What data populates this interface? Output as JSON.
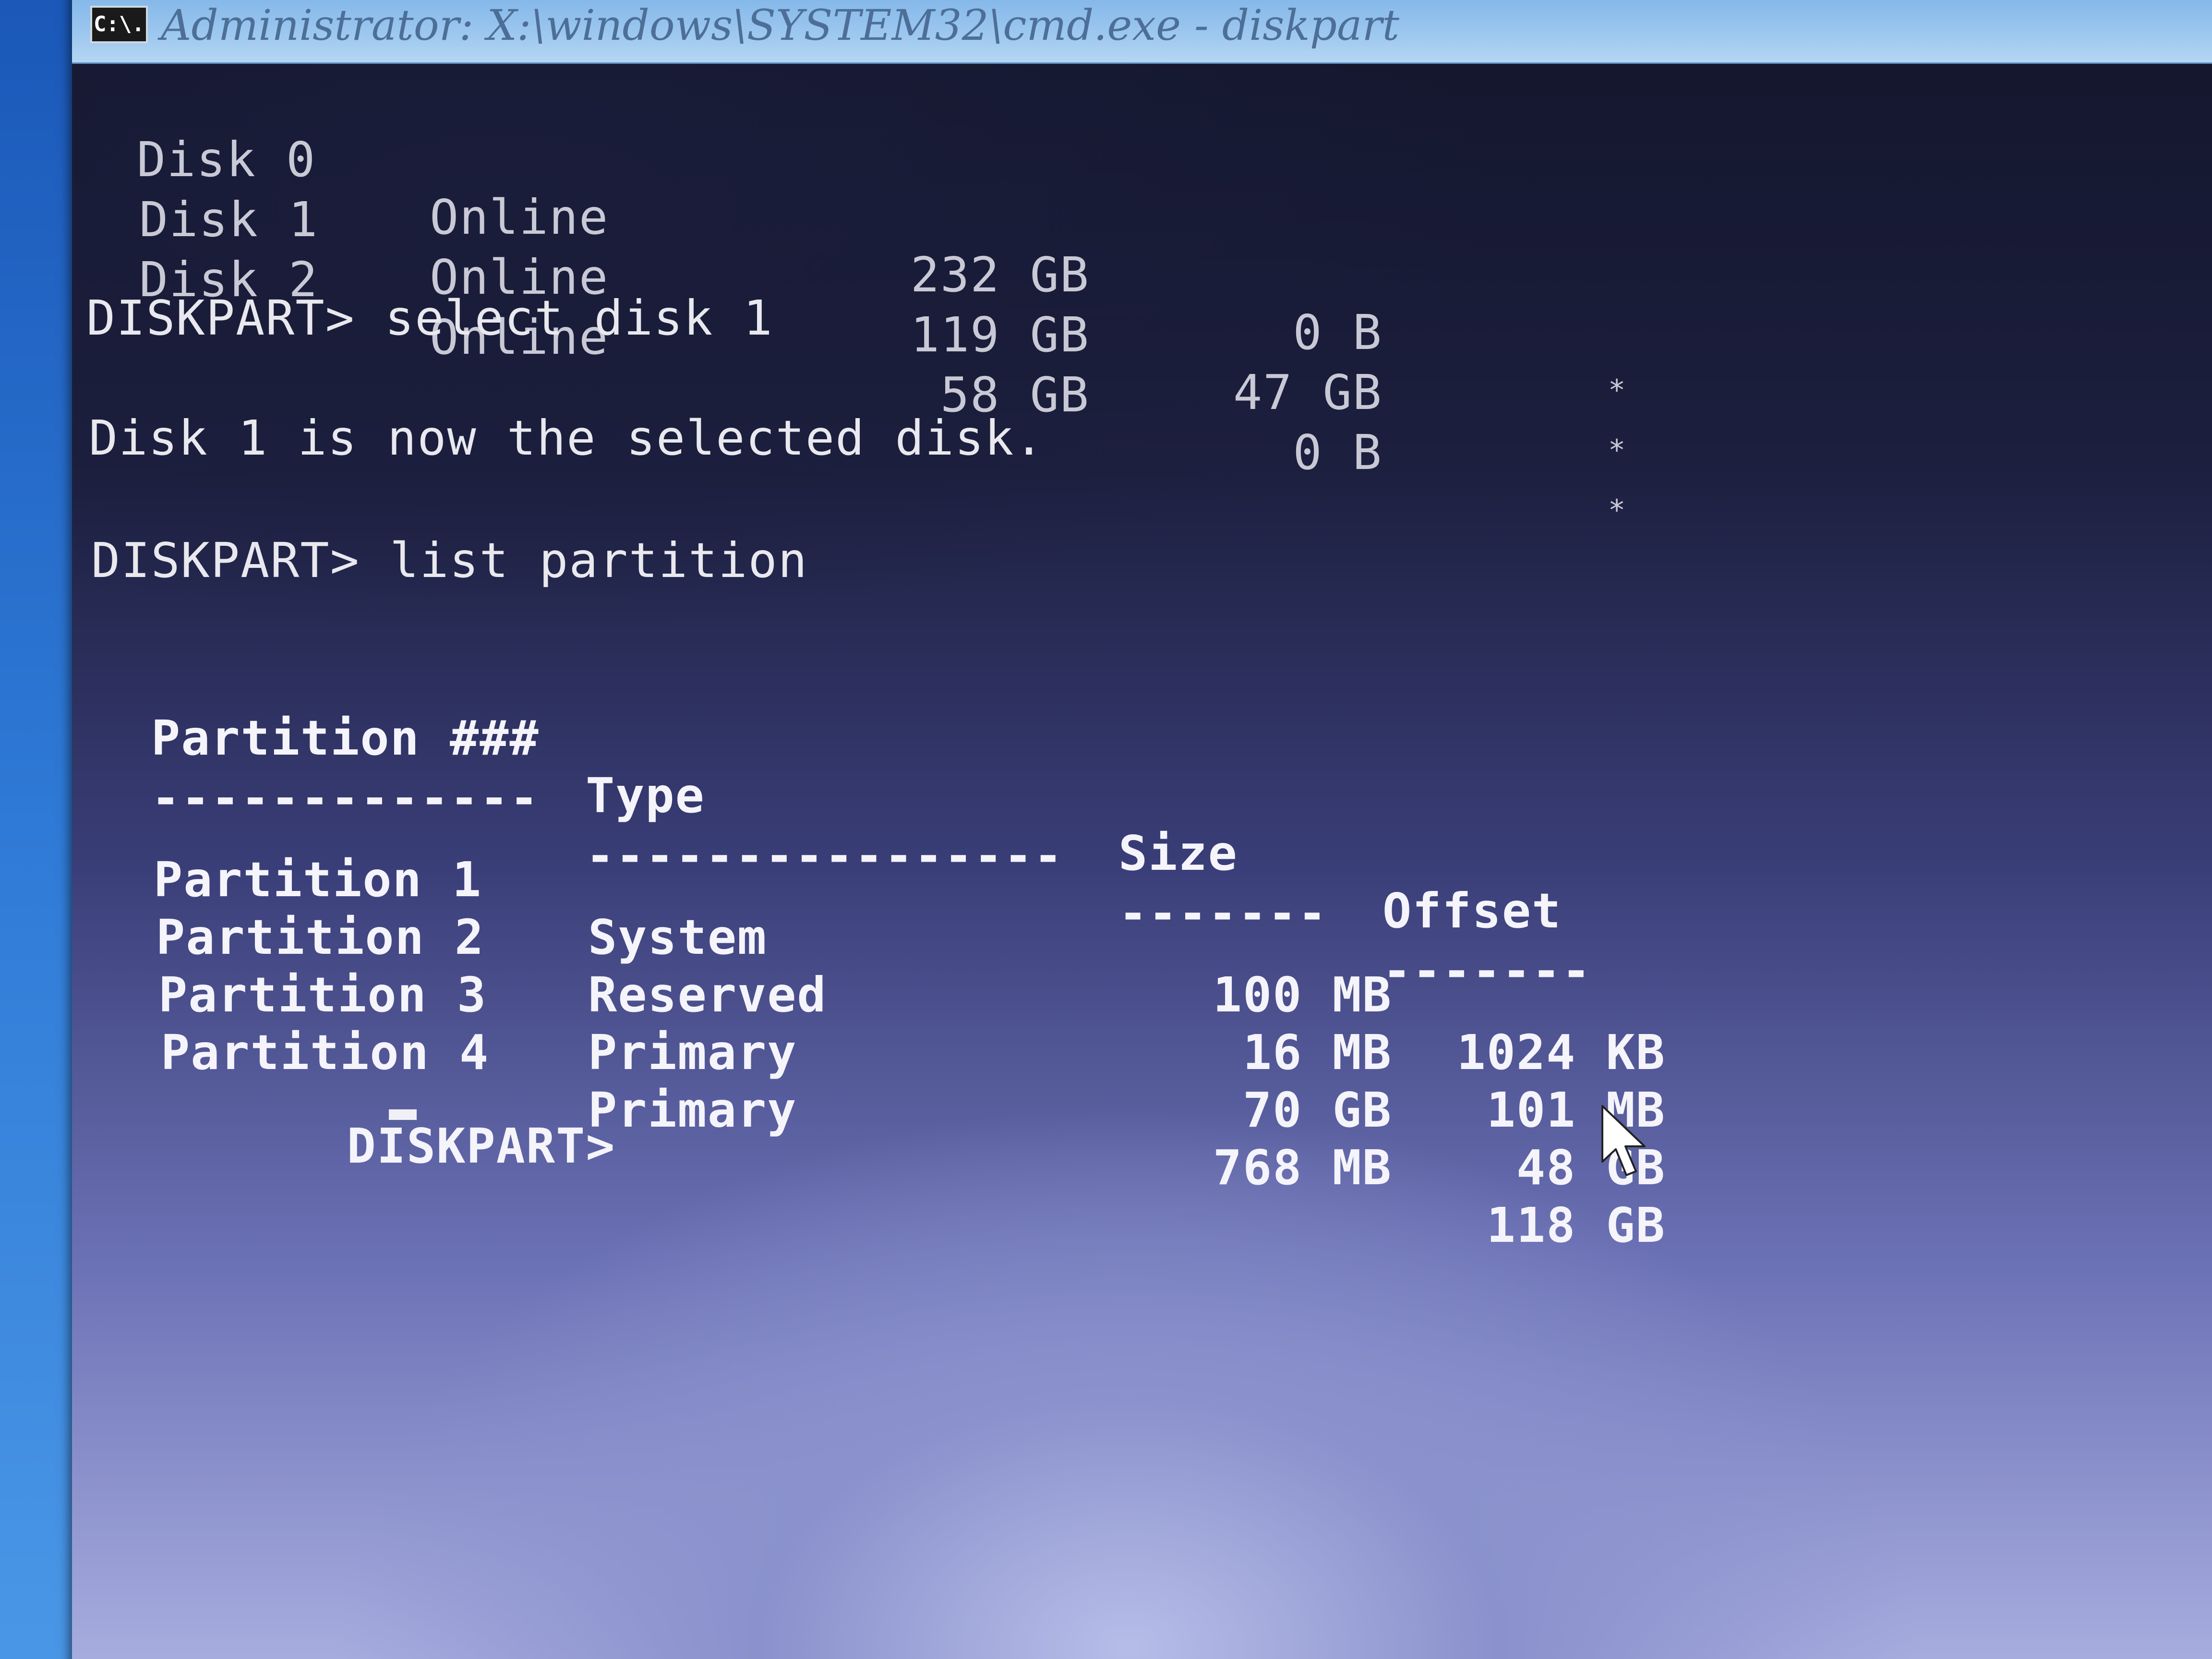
{
  "window": {
    "icon_text": "C:\\.",
    "title": "Administrator: X:\\windows\\SYSTEM32\\cmd.exe - diskpart"
  },
  "disk_list": {
    "rows": [
      {
        "disk": "Disk 0",
        "status": "Online",
        "size": "232 GB",
        "free": "0 B",
        "gpt": "*"
      },
      {
        "disk": "Disk 1",
        "status": "Online",
        "size": "119 GB",
        "free": "47 GB",
        "gpt": "*"
      },
      {
        "disk": "Disk 2",
        "status": "Online",
        "size": "58 GB",
        "free": "0 B",
        "gpt": "*"
      }
    ]
  },
  "console": {
    "cmd1": "DISKPART> select disk 1",
    "msg1": "Disk 1 is now the selected disk.",
    "cmd2": "DISKPART> list partition",
    "prompt": "DISKPART> "
  },
  "partition_table": {
    "headers": {
      "partition": "Partition ###",
      "type": "Type",
      "size": "Size",
      "offset": "Offset"
    },
    "separators": {
      "partition": "-------------",
      "type": "----------------",
      "size": "-------",
      "offset": "-------"
    },
    "rows": [
      {
        "partition": "Partition 1",
        "type": "System",
        "size": "100 MB",
        "offset": "1024 KB"
      },
      {
        "partition": "Partition 2",
        "type": "Reserved",
        "size": "16 MB",
        "offset": "101 MB"
      },
      {
        "partition": "Partition 3",
        "type": "Primary",
        "size": "70 GB",
        "offset": "48 GB"
      },
      {
        "partition": "Partition 4",
        "type": "Primary",
        "size": "768 MB",
        "offset": "118 GB"
      }
    ]
  },
  "icons": {
    "window_icon": "cmd-icon",
    "pointer": "mouse-pointer-icon"
  },
  "colors": {
    "console_text": "#e8e8ee",
    "titlebar": "#9cc7ef"
  }
}
